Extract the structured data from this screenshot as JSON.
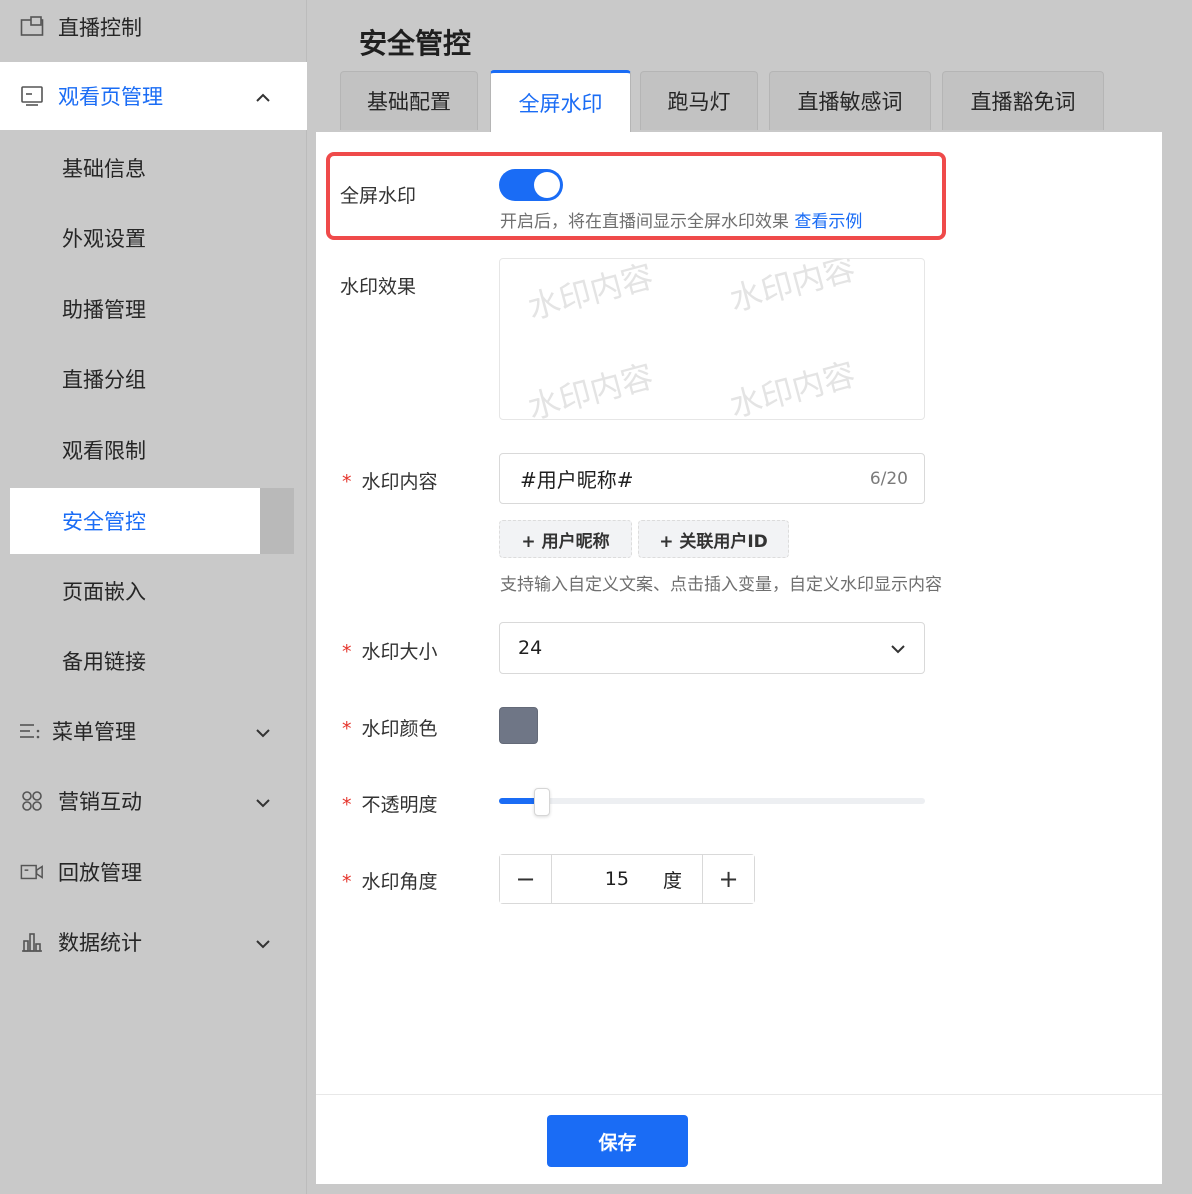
{
  "sidebar": {
    "live_control": "直播控制",
    "watch_page": "观看页管理",
    "sub_items": [
      "基础信息",
      "外观设置",
      "助播管理",
      "直播分组",
      "观看限制",
      "安全管控",
      "页面嵌入",
      "备用链接"
    ],
    "menu_manage": "菜单管理",
    "marketing": "营销互动",
    "playback": "回放管理",
    "statistics": "数据统计"
  },
  "header": {
    "title": "安全管控"
  },
  "tabs": [
    "基础配置",
    "全屏水印",
    "跑马灯",
    "直播敏感词",
    "直播豁免词"
  ],
  "form": {
    "fullscreen_watermark_label": "全屏水印",
    "fullscreen_watermark_on": true,
    "fullscreen_hint": "开启后，将在直播间显示全屏水印效果",
    "view_example": "查看示例",
    "effect_label": "水印效果",
    "preview_text": "水印内容",
    "required_mark": "*",
    "content_label": "水印内容",
    "content_value": "#用户昵称#",
    "content_count": "6/20",
    "insert_nickname": "+ 用户昵称",
    "insert_userid": "+ 关联用户ID",
    "content_hint": "支持输入自定义文案、点击插入变量，自定义水印显示内容",
    "size_label": "水印大小",
    "size_value": "24",
    "color_label": "水印颜色",
    "color_value": "#6f7686",
    "opacity_label": "不透明度",
    "opacity_fraction": 0.1,
    "angle_label": "水印角度",
    "angle_value": "15",
    "angle_unit": "度",
    "minus": "−",
    "plus": "+"
  },
  "footer": {
    "save_label": "保存"
  },
  "colors": {
    "accent": "#1a6cf5",
    "highlight": "#ef4a4a",
    "required": "#e5342b"
  }
}
